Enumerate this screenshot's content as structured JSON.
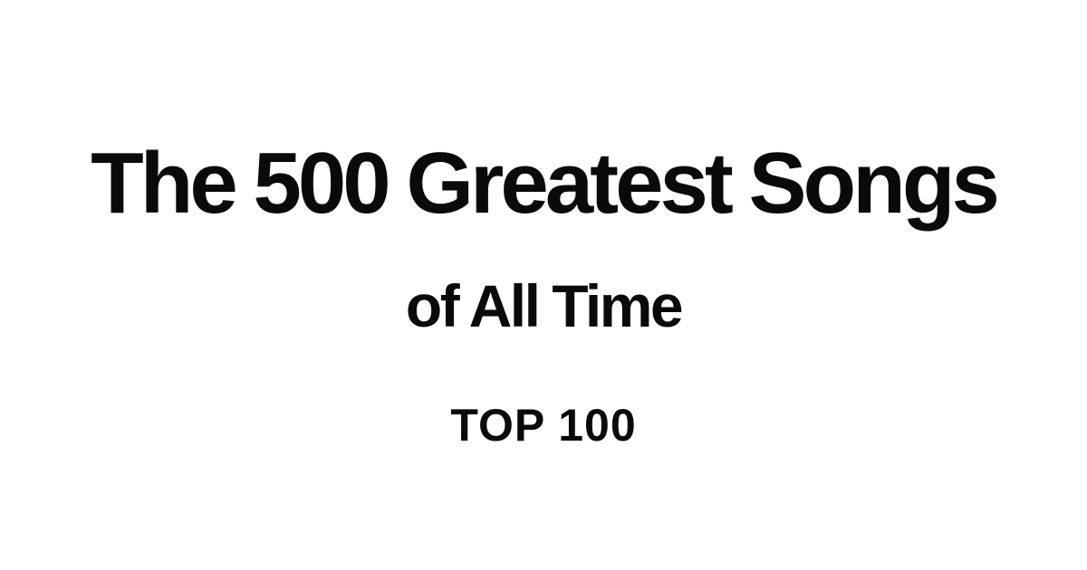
{
  "title": {
    "line1": "The 500 Greatest Songs",
    "line2": "of All Time"
  },
  "tagline": "TOP 100"
}
